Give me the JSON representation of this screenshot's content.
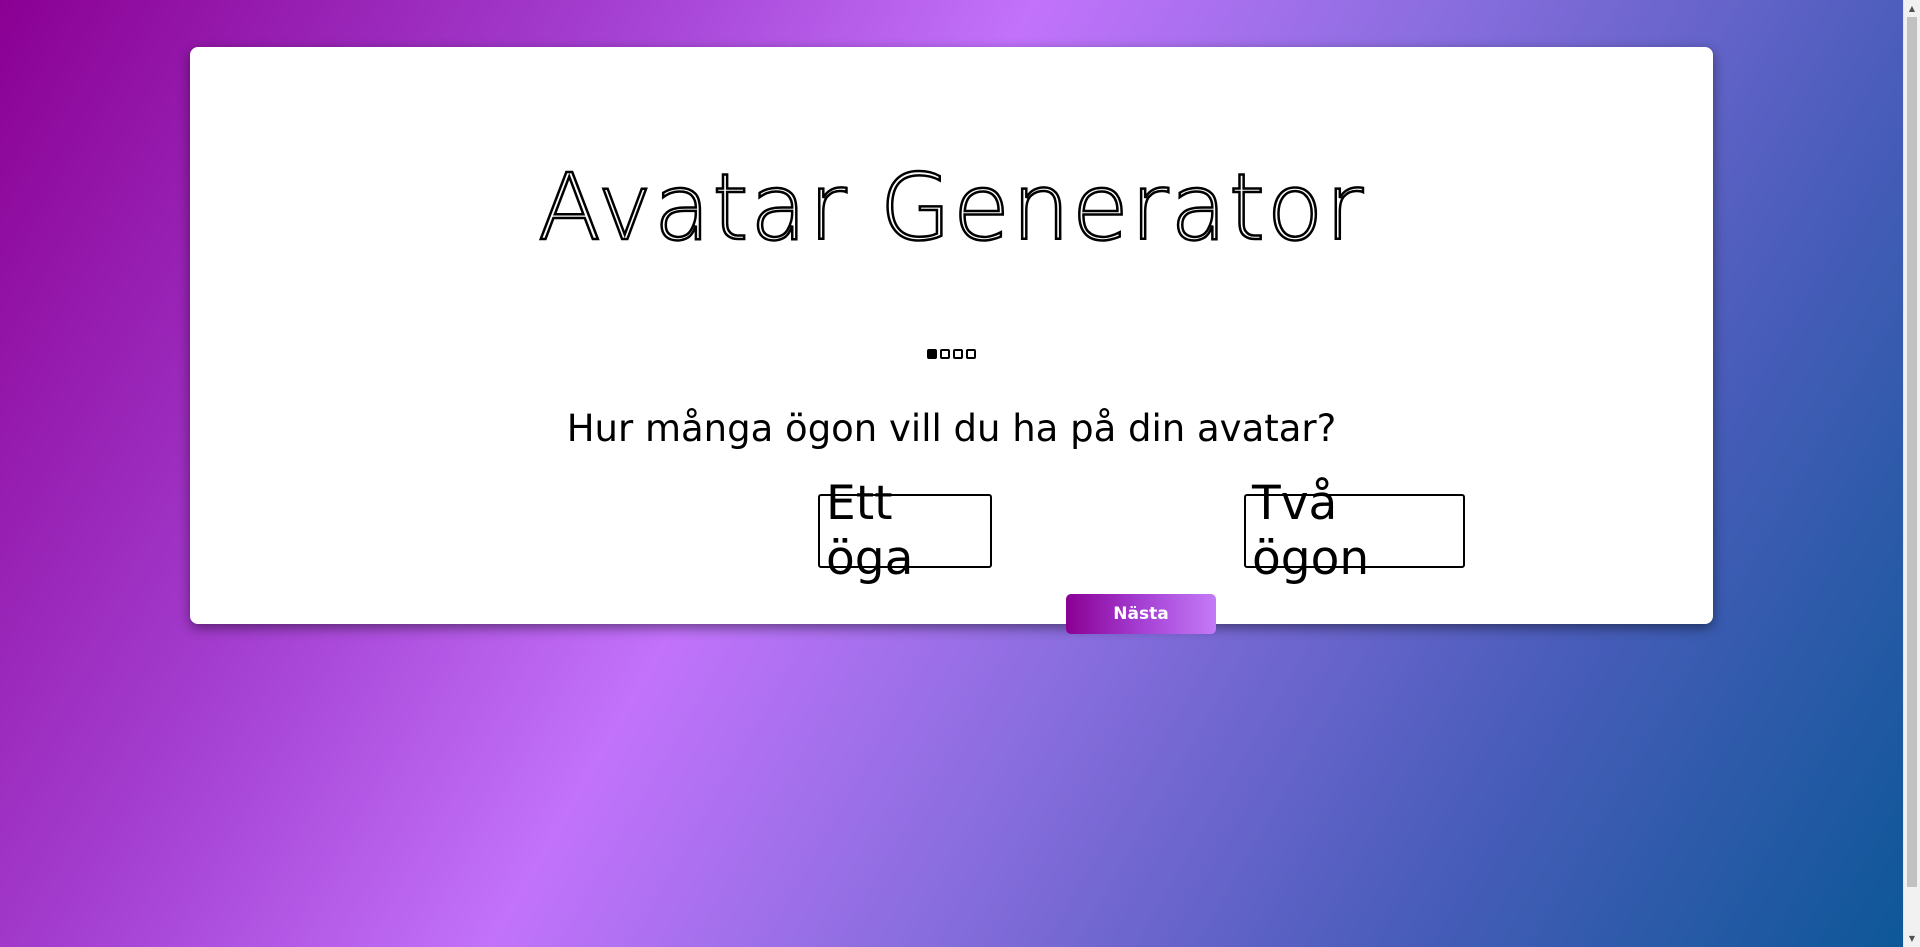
{
  "app": {
    "title": "Avatar Generator"
  },
  "progress": {
    "total_steps": 4,
    "current_step": 1
  },
  "question": {
    "text": "Hur många ögon vill du ha på din avatar?"
  },
  "options": [
    {
      "label": "Ett öga"
    },
    {
      "label": "Två ögon"
    }
  ],
  "actions": {
    "next_label": "Nästa"
  },
  "colors": {
    "accent": "#8a0093",
    "accent_light": "#c47bf8",
    "background_start": "#8a0093",
    "background_end": "#0b5796"
  }
}
